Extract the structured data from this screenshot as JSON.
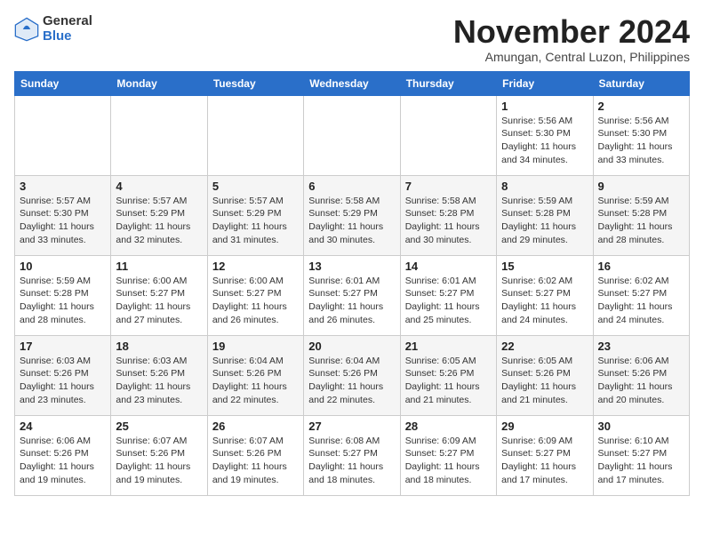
{
  "header": {
    "logo_general": "General",
    "logo_blue": "Blue",
    "month_title": "November 2024",
    "location": "Amungan, Central Luzon, Philippines"
  },
  "days_of_week": [
    "Sunday",
    "Monday",
    "Tuesday",
    "Wednesday",
    "Thursday",
    "Friday",
    "Saturday"
  ],
  "weeks": [
    [
      {
        "day": "",
        "info": ""
      },
      {
        "day": "",
        "info": ""
      },
      {
        "day": "",
        "info": ""
      },
      {
        "day": "",
        "info": ""
      },
      {
        "day": "",
        "info": ""
      },
      {
        "day": "1",
        "info": "Sunrise: 5:56 AM\nSunset: 5:30 PM\nDaylight: 11 hours and 34 minutes."
      },
      {
        "day": "2",
        "info": "Sunrise: 5:56 AM\nSunset: 5:30 PM\nDaylight: 11 hours and 33 minutes."
      }
    ],
    [
      {
        "day": "3",
        "info": "Sunrise: 5:57 AM\nSunset: 5:30 PM\nDaylight: 11 hours and 33 minutes."
      },
      {
        "day": "4",
        "info": "Sunrise: 5:57 AM\nSunset: 5:29 PM\nDaylight: 11 hours and 32 minutes."
      },
      {
        "day": "5",
        "info": "Sunrise: 5:57 AM\nSunset: 5:29 PM\nDaylight: 11 hours and 31 minutes."
      },
      {
        "day": "6",
        "info": "Sunrise: 5:58 AM\nSunset: 5:29 PM\nDaylight: 11 hours and 30 minutes."
      },
      {
        "day": "7",
        "info": "Sunrise: 5:58 AM\nSunset: 5:28 PM\nDaylight: 11 hours and 30 minutes."
      },
      {
        "day": "8",
        "info": "Sunrise: 5:59 AM\nSunset: 5:28 PM\nDaylight: 11 hours and 29 minutes."
      },
      {
        "day": "9",
        "info": "Sunrise: 5:59 AM\nSunset: 5:28 PM\nDaylight: 11 hours and 28 minutes."
      }
    ],
    [
      {
        "day": "10",
        "info": "Sunrise: 5:59 AM\nSunset: 5:28 PM\nDaylight: 11 hours and 28 minutes."
      },
      {
        "day": "11",
        "info": "Sunrise: 6:00 AM\nSunset: 5:27 PM\nDaylight: 11 hours and 27 minutes."
      },
      {
        "day": "12",
        "info": "Sunrise: 6:00 AM\nSunset: 5:27 PM\nDaylight: 11 hours and 26 minutes."
      },
      {
        "day": "13",
        "info": "Sunrise: 6:01 AM\nSunset: 5:27 PM\nDaylight: 11 hours and 26 minutes."
      },
      {
        "day": "14",
        "info": "Sunrise: 6:01 AM\nSunset: 5:27 PM\nDaylight: 11 hours and 25 minutes."
      },
      {
        "day": "15",
        "info": "Sunrise: 6:02 AM\nSunset: 5:27 PM\nDaylight: 11 hours and 24 minutes."
      },
      {
        "day": "16",
        "info": "Sunrise: 6:02 AM\nSunset: 5:27 PM\nDaylight: 11 hours and 24 minutes."
      }
    ],
    [
      {
        "day": "17",
        "info": "Sunrise: 6:03 AM\nSunset: 5:26 PM\nDaylight: 11 hours and 23 minutes."
      },
      {
        "day": "18",
        "info": "Sunrise: 6:03 AM\nSunset: 5:26 PM\nDaylight: 11 hours and 23 minutes."
      },
      {
        "day": "19",
        "info": "Sunrise: 6:04 AM\nSunset: 5:26 PM\nDaylight: 11 hours and 22 minutes."
      },
      {
        "day": "20",
        "info": "Sunrise: 6:04 AM\nSunset: 5:26 PM\nDaylight: 11 hours and 22 minutes."
      },
      {
        "day": "21",
        "info": "Sunrise: 6:05 AM\nSunset: 5:26 PM\nDaylight: 11 hours and 21 minutes."
      },
      {
        "day": "22",
        "info": "Sunrise: 6:05 AM\nSunset: 5:26 PM\nDaylight: 11 hours and 21 minutes."
      },
      {
        "day": "23",
        "info": "Sunrise: 6:06 AM\nSunset: 5:26 PM\nDaylight: 11 hours and 20 minutes."
      }
    ],
    [
      {
        "day": "24",
        "info": "Sunrise: 6:06 AM\nSunset: 5:26 PM\nDaylight: 11 hours and 19 minutes."
      },
      {
        "day": "25",
        "info": "Sunrise: 6:07 AM\nSunset: 5:26 PM\nDaylight: 11 hours and 19 minutes."
      },
      {
        "day": "26",
        "info": "Sunrise: 6:07 AM\nSunset: 5:26 PM\nDaylight: 11 hours and 19 minutes."
      },
      {
        "day": "27",
        "info": "Sunrise: 6:08 AM\nSunset: 5:27 PM\nDaylight: 11 hours and 18 minutes."
      },
      {
        "day": "28",
        "info": "Sunrise: 6:09 AM\nSunset: 5:27 PM\nDaylight: 11 hours and 18 minutes."
      },
      {
        "day": "29",
        "info": "Sunrise: 6:09 AM\nSunset: 5:27 PM\nDaylight: 11 hours and 17 minutes."
      },
      {
        "day": "30",
        "info": "Sunrise: 6:10 AM\nSunset: 5:27 PM\nDaylight: 11 hours and 17 minutes."
      }
    ]
  ]
}
